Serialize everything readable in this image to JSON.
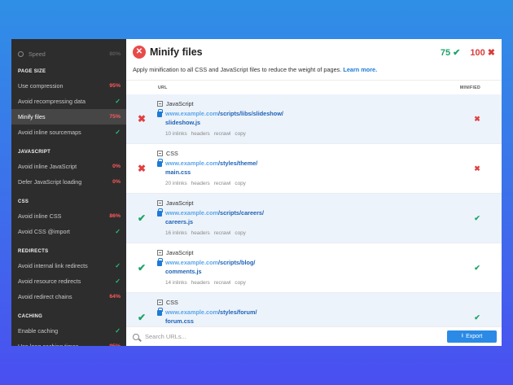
{
  "sidebar": {
    "speed": {
      "label": "Speed",
      "value": "80%"
    },
    "sections": [
      {
        "header": "PAGE SIZE",
        "items": [
          {
            "label": "Use compression",
            "value": "95%",
            "kind": "red"
          },
          {
            "label": "Avoid recompressing data",
            "value": "✓",
            "kind": "check"
          },
          {
            "label": "Minify files",
            "value": "75%",
            "kind": "red",
            "active": true
          },
          {
            "label": "Avoid inline sourcemaps",
            "value": "✓",
            "kind": "check"
          }
        ]
      },
      {
        "header": "JAVASCRIPT",
        "items": [
          {
            "label": "Avoid inline JavaScript",
            "value": "0%",
            "kind": "red"
          },
          {
            "label": "Defer JavaScript loading",
            "value": "0%",
            "kind": "red"
          }
        ]
      },
      {
        "header": "CSS",
        "items": [
          {
            "label": "Avoid inline CSS",
            "value": "86%",
            "kind": "red"
          },
          {
            "label": "Avoid CSS @import",
            "value": "✓",
            "kind": "check"
          }
        ]
      },
      {
        "header": "REDIRECTS",
        "items": [
          {
            "label": "Avoid internal link redirects",
            "value": "✓",
            "kind": "check"
          },
          {
            "label": "Avoid resource redirects",
            "value": "✓",
            "kind": "check"
          },
          {
            "label": "Avoid redirect chains",
            "value": "64%",
            "kind": "red"
          }
        ]
      },
      {
        "header": "CACHING",
        "items": [
          {
            "label": "Enable caching",
            "value": "✓",
            "kind": "check"
          },
          {
            "label": "Use long caching times",
            "value": "95%",
            "kind": "red"
          }
        ]
      }
    ]
  },
  "main": {
    "title": "Minify files",
    "score_good": "75",
    "score_bad": "100",
    "description": "Apply minification to all CSS and JavaScript files to reduce the weight of pages.",
    "learn_more": "Learn more.",
    "col_url": "URL",
    "col_minified": "MINIFIED",
    "rows": [
      {
        "status": "fail",
        "type": "JavaScript",
        "domain": "www.example.com",
        "path1": "/scripts/libs/slideshow/",
        "path2": "slideshow.js",
        "inlinks": "10 inlinks",
        "minified": "fail"
      },
      {
        "status": "fail",
        "type": "CSS",
        "domain": "www.example.com",
        "path1": "/styles/theme/",
        "path2": "main.css",
        "inlinks": "20 inlinks",
        "minified": "fail"
      },
      {
        "status": "ok",
        "type": "JavaScript",
        "domain": "www.example.com",
        "path1": "/scripts/careers/",
        "path2": "careers.js",
        "inlinks": "16 inlinks",
        "minified": "ok"
      },
      {
        "status": "ok",
        "type": "JavaScript",
        "domain": "www.example.com",
        "path1": "/scripts/blog/",
        "path2": "comments.js",
        "inlinks": "14 inlinks",
        "minified": "ok"
      },
      {
        "status": "ok",
        "type": "CSS",
        "domain": "www.example.com",
        "path1": "/styles/forum/",
        "path2": "forum.css",
        "inlinks": "",
        "minified": "ok"
      }
    ],
    "row_actions": {
      "headers": "headers",
      "recrawl": "recrawl",
      "copy": "copy"
    }
  },
  "footer": {
    "search_placeholder": "Search URLs...",
    "export_label": "Export"
  },
  "colors": {
    "fail": "#e04040",
    "ok": "#1fa36a",
    "accent": "#2a8ae6"
  }
}
